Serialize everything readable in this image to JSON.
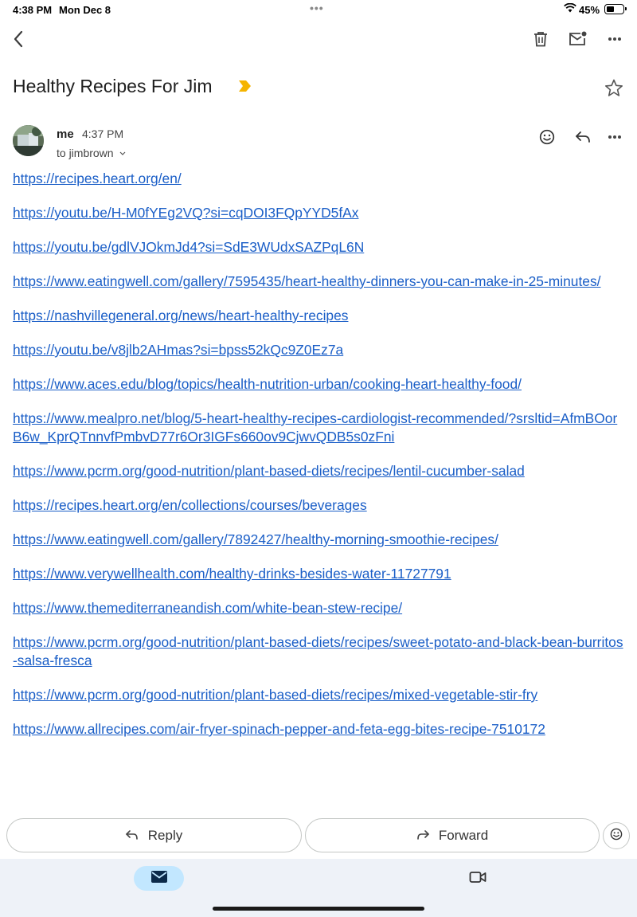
{
  "status_bar": {
    "time": "4:38 PM",
    "date": "Mon Dec 8",
    "battery_percent": "45%",
    "battery_level": 0.45,
    "icons": [
      "wifi-icon",
      "battery-icon"
    ]
  },
  "toolbar": {
    "icons": [
      "back-arrow-icon",
      "trash-icon",
      "mark-unread-icon",
      "more-vert-icon"
    ]
  },
  "email": {
    "subject": "Healthy Recipes For Jim",
    "label_color": "#f5b400",
    "sender": "me",
    "time": "4:37 PM",
    "recipient": "to jimbrown",
    "links": [
      "https://recipes.heart.org/en/",
      "https://youtu.be/H-M0fYEg2VQ?si=cqDOI3FQpYYD5fAx",
      "https://youtu.be/gdlVJOkmJd4?si=SdE3WUdxSAZPqL6N",
      "https://www.eatingwell.com/gallery/7595435/heart-healthy-dinners-you-can-make-in-25-minutes/",
      "https://nashvillegeneral.org/news/heart-healthy-recipes",
      "https://youtu.be/v8jlb2AHmas?si=bpss52kQc9Z0Ez7a",
      "https://www.aces.edu/blog/topics/health-nutrition-urban/cooking-heart-healthy-food/",
      "https://www.mealpro.net/blog/5-heart-healthy-recipes-cardiologist-recommended/?srsltid=AfmBOorB6w_KprQTnnvfPmbvD77r6Or3IGFs660ov9CjwvQDB5s0zFni",
      "https://www.pcrm.org/good-nutrition/plant-based-diets/recipes/lentil-cucumber-salad",
      "https://recipes.heart.org/en/collections/courses/beverages",
      "https://www.eatingwell.com/gallery/7892427/healthy-morning-smoothie-recipes/",
      "https://www.verywellhealth.com/healthy-drinks-besides-water-11727791",
      "https://www.themediterraneandish.com/white-bean-stew-recipe/",
      "https://www.pcrm.org/good-nutrition/plant-based-diets/recipes/sweet-potato-and-black-bean-burritos-salsa-fresca",
      "https://www.pcrm.org/good-nutrition/plant-based-diets/recipes/mixed-vegetable-stir-fry",
      "https://www.allrecipes.com/air-fryer-spinach-pepper-and-feta-egg-bites-recipe-7510172"
    ]
  },
  "actions": {
    "reply_label": "Reply",
    "forward_label": "Forward"
  },
  "bottom_nav": {
    "icons": [
      "mail-icon",
      "video-icon"
    ],
    "active_color": "#c2e7ff"
  }
}
